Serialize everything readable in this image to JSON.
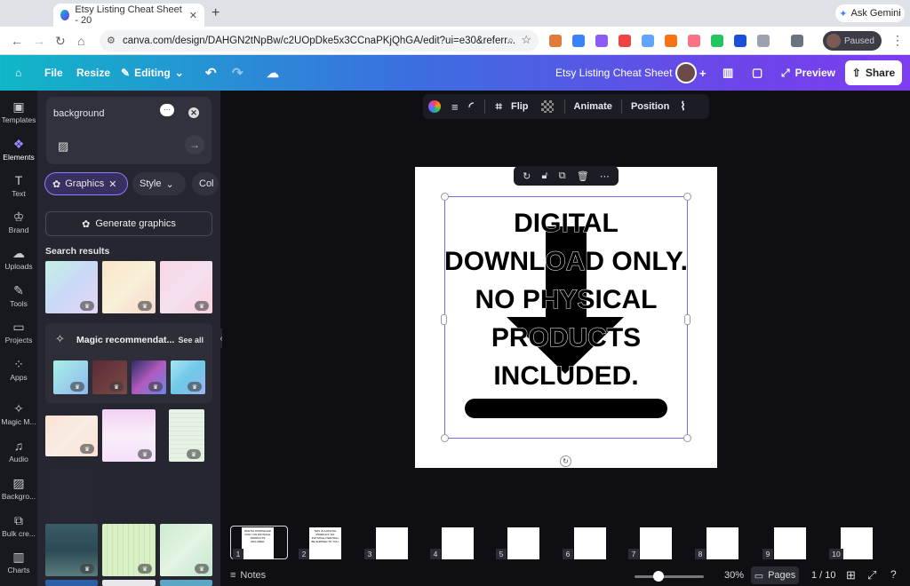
{
  "browser": {
    "tab_title": "Etsy Listing Cheat Sheet - 20",
    "url": "canva.com/design/DAHGN2tNpBw/c2UOpDke5x3CCnaPKjQhGA/edit?ui=e30&referr...",
    "gemini_label": "Ask Gemini",
    "profile_label": "Paused"
  },
  "header": {
    "file": "File",
    "resize": "Resize",
    "editing": "Editing",
    "doc_title": "Etsy Listing Cheat Sheet",
    "preview": "Preview",
    "share": "Share"
  },
  "rail": [
    {
      "label": "Templates",
      "icon": "templates-icon"
    },
    {
      "label": "Elements",
      "icon": "elements-icon"
    },
    {
      "label": "Text",
      "icon": "text-icon"
    },
    {
      "label": "Brand",
      "icon": "brand-icon"
    },
    {
      "label": "Uploads",
      "icon": "uploads-icon"
    },
    {
      "label": "Tools",
      "icon": "tools-icon"
    },
    {
      "label": "Projects",
      "icon": "projects-icon"
    },
    {
      "label": "Apps",
      "icon": "apps-icon"
    },
    {
      "label": "Magic M...",
      "icon": "magic-media-icon"
    },
    {
      "label": "Audio",
      "icon": "audio-icon"
    },
    {
      "label": "Backgro...",
      "icon": "background-icon"
    },
    {
      "label": "Bulk cre...",
      "icon": "bulk-create-icon"
    },
    {
      "label": "Charts",
      "icon": "charts-icon"
    }
  ],
  "panel": {
    "search_value": "background",
    "chip_graphics": "Graphics",
    "chip_style": "Style",
    "chip_color": "Col",
    "generate": "Generate graphics",
    "results_heading": "Search results",
    "magic_title": "Magic recommendat...",
    "see_all": "See all"
  },
  "toolbar": {
    "flip": "Flip",
    "animate": "Animate",
    "position": "Position"
  },
  "design": {
    "lines": [
      "DIGITAL",
      "DOWNLOAD ONLY.",
      "NO PHYSICAL",
      "PRODUCTS",
      "INCLUDED."
    ]
  },
  "pages": [
    {
      "num": "1",
      "text": "DIGITAL DOWNLOAD ONLY. NO PHYSICAL PRODUCTS INCLUDED."
    },
    {
      "num": "2",
      "text": "THIS IS A DIGITAL PRODUCT. NO PHYSICAL ITEM WILL BE SHIPPED TO YOU."
    },
    {
      "num": "3",
      "text": ""
    },
    {
      "num": "4",
      "text": ""
    },
    {
      "num": "5",
      "text": ""
    },
    {
      "num": "6",
      "text": ""
    },
    {
      "num": "7",
      "text": ""
    },
    {
      "num": "8",
      "text": ""
    },
    {
      "num": "9",
      "text": ""
    },
    {
      "num": "10",
      "text": ""
    }
  ],
  "bottom": {
    "notes": "Notes",
    "zoom": "30%",
    "pages_btn": "Pages",
    "page_count": "1 / 10"
  },
  "colors": {
    "accent": "#8b5cf6",
    "header_start": "#10b7c7",
    "header_end": "#7d3cf0"
  }
}
